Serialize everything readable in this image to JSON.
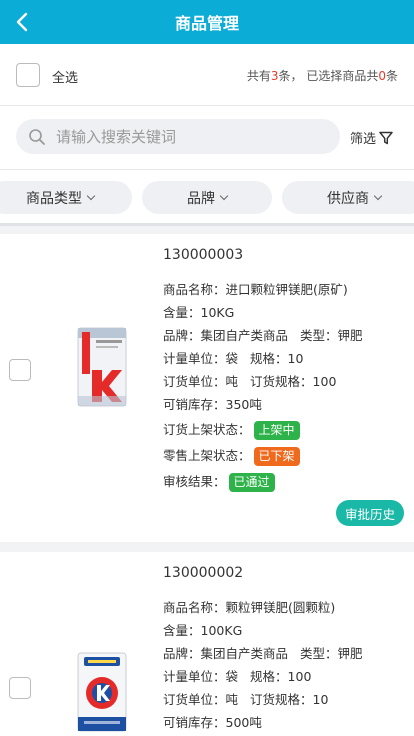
{
  "header": {
    "title": "商品管理"
  },
  "topbar": {
    "select_all_label": "全选",
    "count_prefix": "共有",
    "total_count": "3",
    "count_middle": "条，  已选择商品共",
    "selected_count": "0",
    "count_suffix": "条"
  },
  "search": {
    "placeholder": "请输入搜索关键词",
    "filter_label": "筛选"
  },
  "tabs": [
    {
      "label": "商品类型"
    },
    {
      "label": "品牌"
    },
    {
      "label": "供应商"
    }
  ],
  "products": [
    {
      "code": "130000003",
      "name_label": "商品名称：",
      "name": "进口颗粒钾镁肥(原矿)",
      "content_label": "含量：",
      "content": "10KG",
      "brand_label": "品牌：",
      "brand": "集团自产类商品",
      "type_label": "类型：",
      "type": "钾肥",
      "unit_label": "计量单位：",
      "unit": "袋",
      "spec_label": "规格：",
      "spec": "10",
      "order_unit_label": "订货单位：",
      "order_unit": "吨",
      "order_spec_label": "订货规格：",
      "order_spec": "100",
      "stock_label": "可销库存：",
      "stock": "350吨",
      "order_status_label": "订货上架状态：",
      "order_status": "上架中",
      "retail_status_label": "零售上架状态：",
      "retail_status": "已下架",
      "audit_label": "审核结果：",
      "audit": "已通过",
      "history_button": "审批历史"
    },
    {
      "code": "130000002",
      "name_label": "商品名称：",
      "name": "颗粒钾镁肥(圆颗粒)",
      "content_label": "含量：",
      "content": "100KG",
      "brand_label": "品牌：",
      "brand": "集团自产类商品",
      "type_label": "类型：",
      "type": "钾肥",
      "unit_label": "计量单位：",
      "unit": "袋",
      "spec_label": "规格：",
      "spec": "100",
      "order_unit_label": "订货单位：",
      "order_unit": "吨",
      "order_spec_label": "订货规格：",
      "order_spec": "10",
      "stock_label": "可销库存：",
      "stock": "500吨"
    }
  ],
  "colors": {
    "header": "#0bacd5",
    "highlight": "#e23b2e",
    "tag_green": "#2eb34a",
    "tag_orange": "#f06a1d",
    "history_button": "#1ab8a6"
  },
  "icons": {
    "back": "chevron-left-icon",
    "search": "search-icon",
    "filter": "filter-funnel-icon"
  }
}
